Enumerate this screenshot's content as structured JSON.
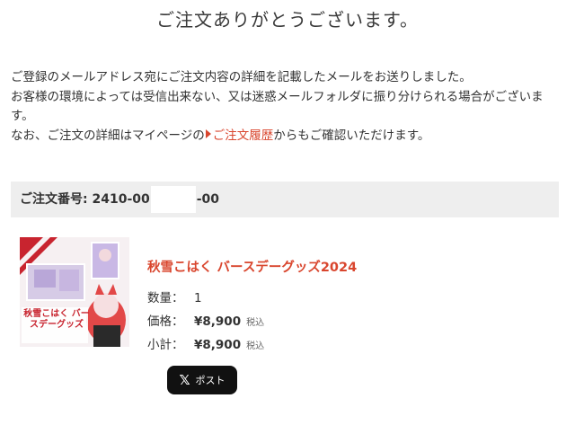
{
  "page": {
    "title": "ご注文ありがとうございます。"
  },
  "message": {
    "line1": "ご登録のメールアドレス宛にご注文内容の詳細を記載したメールをお送りしました。",
    "line2": "お客様の環境によっては受信出来ない、又は迷惑メールフォルダに振り分けられる場合がございます。",
    "line3_before": "なお、ご注文の詳細はマイページの",
    "history_link": "ご注文履歴",
    "line3_after": "からもご確認いただけます。"
  },
  "order": {
    "label": "ご注文番号: ",
    "number_prefix": "2410-00",
    "number_suffix": "-00"
  },
  "product": {
    "name": "秋雪こはく バースデーグッズ2024",
    "thumbnail_text": "秋雪こはく バースデーグッズ",
    "quantity_label": "数量：",
    "quantity": "1",
    "price_label": "価格：",
    "price": "¥8,900",
    "subtotal_label": "小計：",
    "subtotal": "¥8,900",
    "tax_note": "税込"
  },
  "share": {
    "post_label": "ポスト",
    "icon": "x-logo-icon"
  },
  "colors": {
    "accent": "#d9462e",
    "order_bar_bg": "#eeeeee",
    "button_bg": "#111111"
  }
}
